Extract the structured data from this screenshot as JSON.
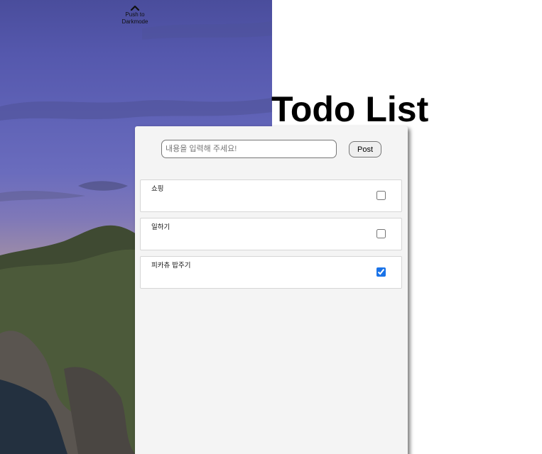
{
  "darkmode": {
    "label_line1": "Push to",
    "label_line2": "Darkmode",
    "icon": "chevron-up-icon"
  },
  "title": "Todo List",
  "form": {
    "placeholder": "내용을 입력해 주세요!",
    "value": "",
    "post_label": "Post"
  },
  "todos": [
    {
      "text": "쇼핑",
      "done": false
    },
    {
      "text": "일하기",
      "done": false
    },
    {
      "text": "피카츄 밥주기",
      "done": true
    }
  ]
}
